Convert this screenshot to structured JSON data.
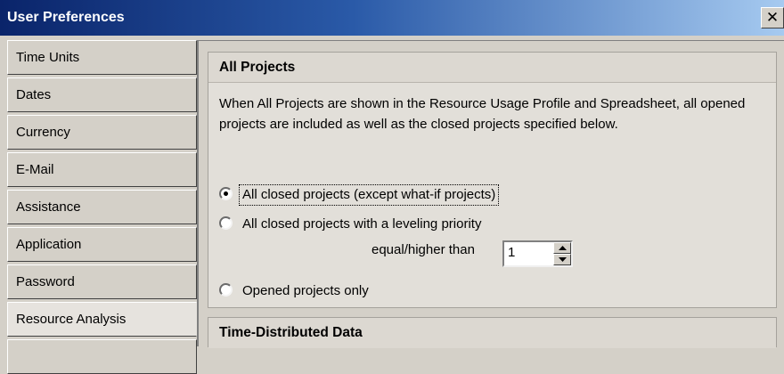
{
  "window": {
    "title": "User Preferences",
    "close_glyph": "✕"
  },
  "sidebar": {
    "items": [
      {
        "label": "Time Units",
        "selected": false
      },
      {
        "label": "Dates",
        "selected": false
      },
      {
        "label": "Currency",
        "selected": false
      },
      {
        "label": "E-Mail",
        "selected": false
      },
      {
        "label": "Assistance",
        "selected": false
      },
      {
        "label": "Application",
        "selected": false
      },
      {
        "label": "Password",
        "selected": false
      },
      {
        "label": "Resource Analysis",
        "selected": true
      }
    ]
  },
  "all_projects": {
    "header": "All Projects",
    "description": "When All Projects are shown in the Resource Usage Profile and Spreadsheet, all opened projects are included as well as the closed projects specified below.",
    "options": [
      {
        "label": "All closed projects (except what-if projects)",
        "selected": true
      },
      {
        "label": "All closed projects with a leveling priority",
        "selected": false
      },
      {
        "label": "Opened projects only",
        "selected": false
      }
    ],
    "priority_label": "equal/higher than",
    "priority_value": "1"
  },
  "time_distributed": {
    "header": "Time-Distributed Data"
  }
}
